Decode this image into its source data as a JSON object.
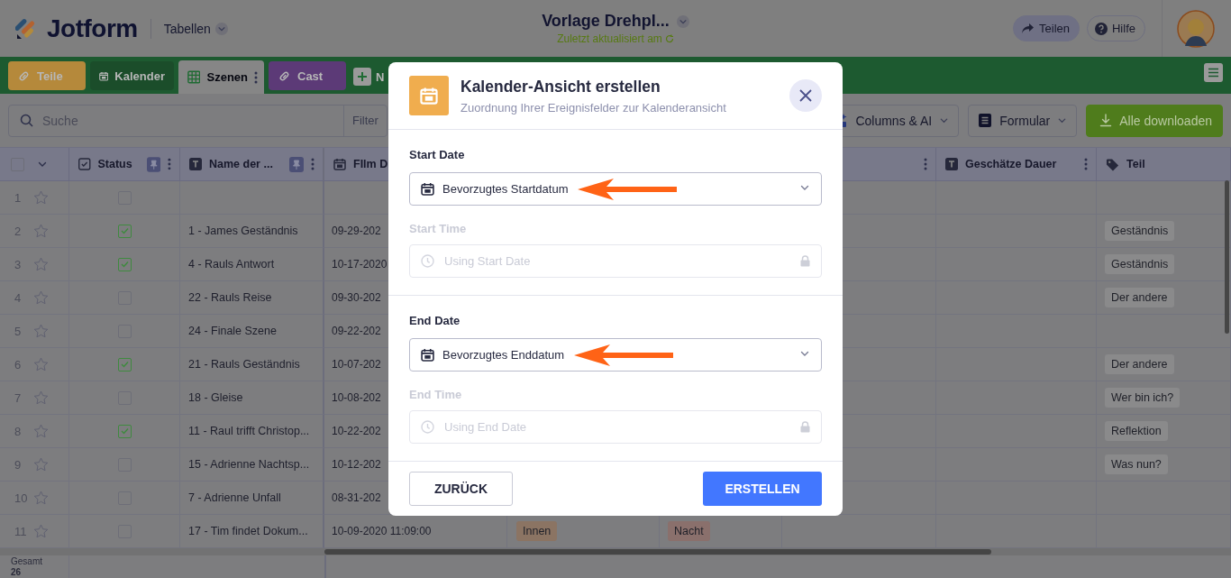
{
  "header": {
    "logo": "Jotform",
    "menu": "Tabellen",
    "title": "Vorlage Drehpl...",
    "subtitle": "Zuletzt aktualisiert am",
    "buttons": [
      {
        "label": "Teilen",
        "kind": "share"
      },
      {
        "label": "Hilfe",
        "kind": "help"
      }
    ]
  },
  "tabs": [
    {
      "label": "Teile",
      "kind": "link",
      "color": "#b5893b",
      "selected": false
    },
    {
      "label": "Kalender",
      "kind": "calendar",
      "color": "#1b4d2a",
      "selected": false
    },
    {
      "label": "Szenen",
      "kind": "grid",
      "color": "#868686",
      "selected": true
    },
    {
      "label": "Cast",
      "kind": "link",
      "color": "#5c3a77",
      "selected": false
    }
  ],
  "new_tab": {
    "label": "N"
  },
  "toolbar": {
    "search": {
      "placeholder": "Suche"
    },
    "filter": "Filter",
    "buttons": [
      {
        "label": "Columns & AI",
        "kind": "columns"
      },
      {
        "label": "Formular",
        "kind": "form"
      },
      {
        "label": "Alle downloaden",
        "kind": "download"
      }
    ]
  },
  "table": {
    "columns": [
      {
        "kind": "checkbox",
        "label": "Status",
        "pinned": true,
        "menu": true
      },
      {
        "kind": "text",
        "label": "Name der ...",
        "pinned": true,
        "menu": true
      },
      {
        "kind": "date",
        "label": "FIlm D"
      },
      {
        "kind": "covered"
      },
      {
        "kind": "covered"
      },
      {
        "kind": "covered",
        "menu": true
      },
      {
        "kind": "text",
        "label": "Geschätze Dauer",
        "pinned": false,
        "menu": true
      },
      {
        "kind": "tag",
        "label": "Teil",
        "pinned": false,
        "menu": false
      }
    ],
    "select_all_checked": false,
    "rows": [
      {
        "num": "1",
        "checked": false
      },
      {
        "num": "2",
        "checked": true,
        "name": "1 - James Geständnis",
        "date": "09-29-202",
        "teil": "Geständnis"
      },
      {
        "num": "3",
        "checked": true,
        "name": "4 - Rauls Antwort",
        "date": "10-17-2020",
        "teil": "Geständnis"
      },
      {
        "num": "4",
        "checked": false,
        "name": "22 - Rauls Reise",
        "date": "09-30-202",
        "teil": "Der andere"
      },
      {
        "num": "5",
        "checked": false,
        "name": "24 - Finale Szene",
        "date": "09-22-202"
      },
      {
        "num": "6",
        "checked": true,
        "name": "21 - Rauls Geständnis",
        "date": "10-07-202",
        "teil": "Der andere"
      },
      {
        "num": "7",
        "checked": false,
        "name": "18 - Gleise",
        "date": "10-08-202",
        "teil": "Wer bin ich?"
      },
      {
        "num": "8",
        "checked": true,
        "name": "11 - Raul trifft Christop...",
        "date": "10-22-202",
        "teil": "Reflektion"
      },
      {
        "num": "9",
        "checked": false,
        "name": "15 - Adrienne Nachtsp...",
        "date": "10-12-202",
        "teil": "Was nun?"
      },
      {
        "num": "10",
        "checked": false,
        "name": "7 - Adrienne Unfall",
        "date": "08-31-202"
      },
      {
        "num": "11",
        "checked": false,
        "name": "17 - Tim findet Dokum...",
        "date": "10-09-2020 11:09:00",
        "inout": {
          "text": "Innen",
          "color": "#8b7463"
        },
        "daynight": {
          "text": "Nacht",
          "color": "#8a706c"
        }
      }
    ],
    "footer": {
      "label": "Gesamt",
      "count": "26"
    }
  },
  "dialog": {
    "title": "Kalender-Ansicht erstellen",
    "subtitle": "Zuordnung Ihrer Ereignisfelder zur Kalenderansicht",
    "sections": [
      {
        "fields": [
          {
            "kind": "select",
            "label": "Start Date",
            "value": "Bevorzugtes Startdatum",
            "annotated": true,
            "disabled": false
          },
          {
            "kind": "locked",
            "label": "Start Time",
            "placeholder": "Using Start Date",
            "disabled": true
          }
        ]
      },
      {
        "fields": [
          {
            "kind": "select",
            "label": "End Date",
            "value": "Bevorzugtes Enddatum",
            "annotated": true,
            "disabled": false
          },
          {
            "kind": "locked",
            "label": "End Time",
            "placeholder": "Using End Date",
            "disabled": true
          }
        ]
      }
    ],
    "buttons": [
      {
        "label": "ZURÜCK",
        "kind": "secondary"
      },
      {
        "label": "ERSTELLEN",
        "kind": "primary"
      }
    ]
  }
}
